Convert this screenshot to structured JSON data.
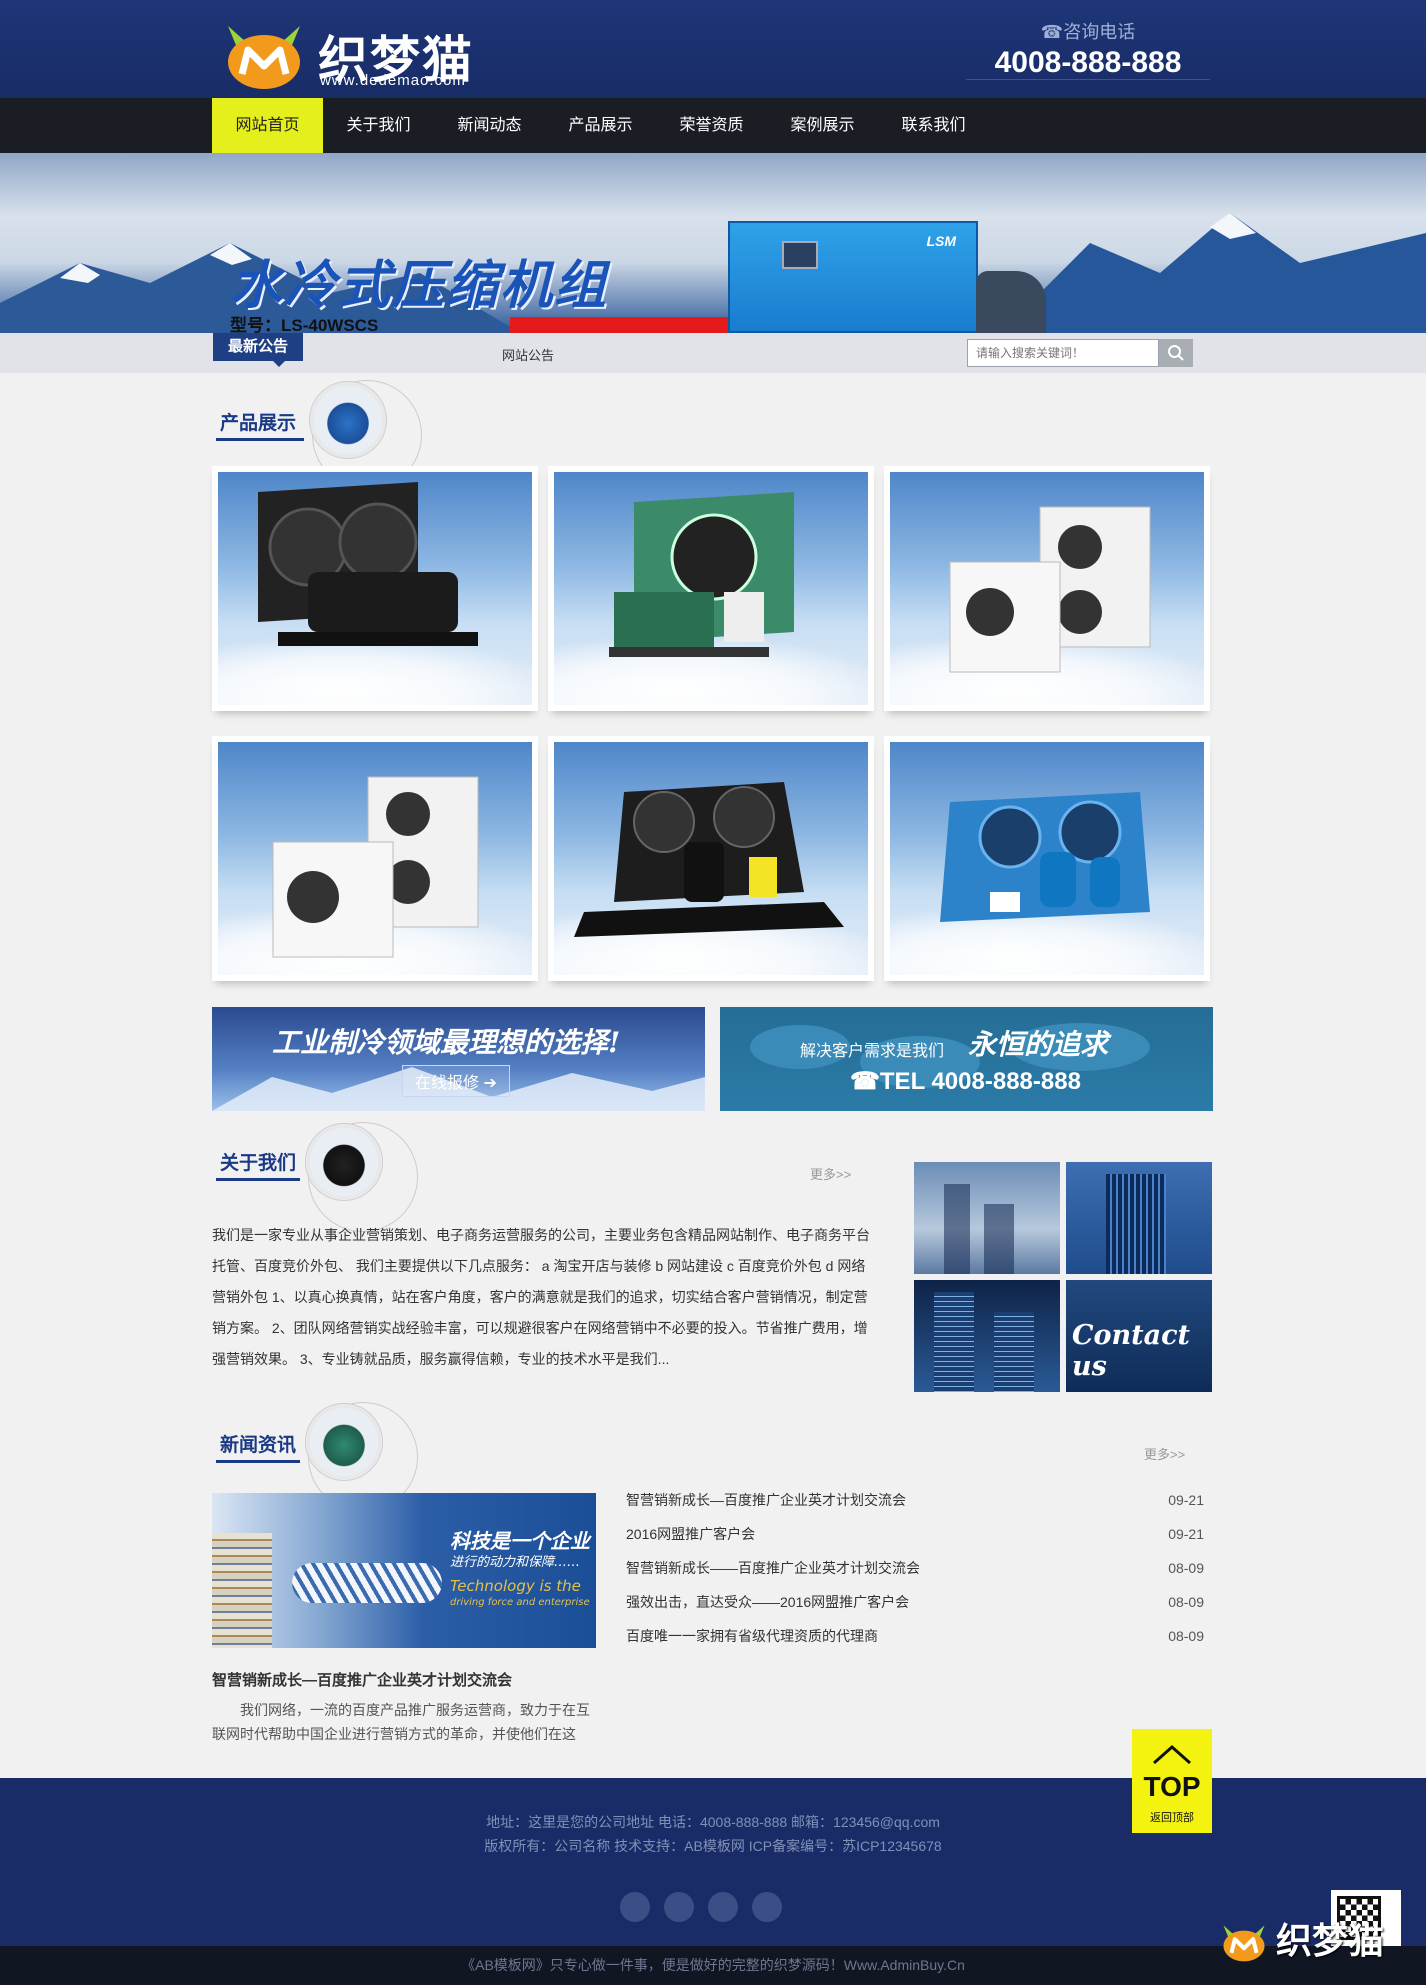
{
  "header": {
    "brand": "织梦猫",
    "url": "www.dedemao.com",
    "hotline_label": "☎咨询电话",
    "hotline_number": "4008-888-888"
  },
  "nav": {
    "items": [
      "网站首页",
      "关于我们",
      "新闻动态",
      "产品展示",
      "荣誉资质",
      "案例展示",
      "联系我们"
    ],
    "active_index": 0
  },
  "banner": {
    "title": "水冷式压缩机组",
    "model": "型号：LS-40WSCS",
    "machine_brand": "LSM"
  },
  "notice": {
    "tag": "最新公告",
    "text": "网站公告"
  },
  "search": {
    "placeholder": "请输入搜索关键词！"
  },
  "products": {
    "title": "产品展示",
    "items": [
      "product-1",
      "product-2",
      "product-3",
      "product-4",
      "product-5",
      "product-6"
    ]
  },
  "ads": {
    "ad1_text": "工业制冷领域最理想的选择!",
    "ad1_button": "在线报修",
    "ad2_text_small": "解决客户需求是我们",
    "ad2_text_big": "永恒的追求",
    "ad2_tel": "☎TEL 4008-888-888"
  },
  "about": {
    "title": "关于我们",
    "more": "更多>>",
    "text": "我们是一家专业从事企业营销策划、电子商务运营服务的公司，主要业务包含精品网站制作、电子商务平台托管、百度竞价外包、 我们主要提供以下几点服务： a 淘宝开店与装修 b 网站建设 c 百度竞价外包 d 网络营销外包 1、以真心换真情，站在客户角度，客户的满意就是我们的追求，切实结合客户营销情况，制定营销方案。 2、团队网络营销实战经验丰富，可以规避很客户在网络营销中不必要的投入。节省推广费用，增强营销效果。 3、专业铸就品质，服务赢得信赖，专业的技术水平是我们...",
    "contact_label": "Contact us"
  },
  "news": {
    "title": "新闻资讯",
    "more": "更多>>",
    "featured_title": "智营销新成长—百度推广企业英才计划交流会",
    "featured_desc": "我们网络，一流的百度产品推广服务运营商，致力于在互联网时代帮助中国企业进行营销方式的革命，并使他们在这",
    "image_text_1": "科技是一个企业",
    "image_text_2": "进行的动力和保障……",
    "image_text_3": "Technology is the",
    "image_text_4": "driving force and enterprise",
    "list": [
      {
        "title": "智营销新成长—百度推广企业英才计划交流会",
        "date": "09-21"
      },
      {
        "title": "2016网盟推广客户会",
        "date": "09-21"
      },
      {
        "title": "智营销新成长——百度推广企业英才计划交流会",
        "date": "08-09"
      },
      {
        "title": "强效出击，直达受众——2016网盟推广客户会",
        "date": "08-09"
      },
      {
        "title": "百度唯一一家拥有省级代理资质的代理商",
        "date": "08-09"
      }
    ]
  },
  "top_button": {
    "label": "TOP",
    "sub": "返回顶部"
  },
  "footer": {
    "line1": "地址：这里是您的公司地址    电话：4008-888-888    邮箱：123456@qq.com",
    "line2": "版权所有：公司名称      技术支持：AB模板网      ICP备案编号：苏ICP12345678",
    "copyright": "《AB模板网》只专心做一件事，便是做好的完整的织梦源码！Www.AdminBuy.Cn",
    "watermark": "织梦猫"
  },
  "colors": {
    "header_bg": "#1e3678",
    "nav_active": "#e4ef1c",
    "heading": "#1a3a86",
    "top_button": "#f3f30f"
  }
}
